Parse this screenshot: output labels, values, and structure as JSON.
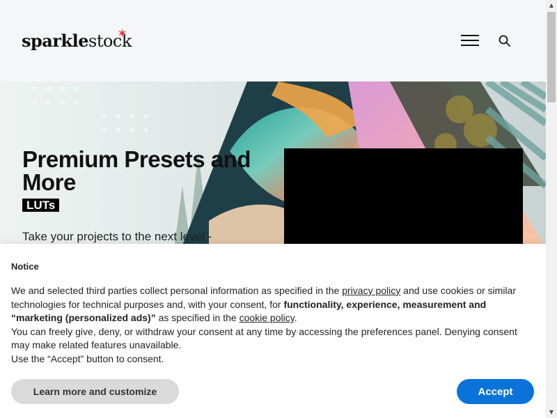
{
  "header": {
    "logo_bold": "sparkle",
    "logo_regular": "stock",
    "logo_star": "✶",
    "icons": [
      "hamburger-menu-icon",
      "search-icon"
    ]
  },
  "hero": {
    "title": "Premium Presets and More",
    "badge": "LUTs",
    "subtitle": "Take your projects to the next level -"
  },
  "consent": {
    "title": "Notice",
    "p1_a": "We and selected third parties collect personal information as specified in the ",
    "privacy_link": "privacy policy",
    "p1_b": " and use cookies or similar technologies for technical purposes and, with your consent, for ",
    "p1_bold": "functionality, experience, measurement and “marketing (personalized ads)”",
    "p1_c": " as specified in the ",
    "cookie_link": "cookie policy",
    "p1_d": ".",
    "p2": "You can freely give, deny, or withdraw your consent at any time by accessing the preferences panel. Denying consent may make related features unavailable.",
    "p3": "Use the “Accept” button to consent.",
    "learn_button": "Learn more and customize",
    "accept_button": "Accept"
  },
  "colors": {
    "accept_blue": "#0a73d9",
    "logo_star_red": "#e8303a",
    "header_bg": "#f5f6f8"
  }
}
